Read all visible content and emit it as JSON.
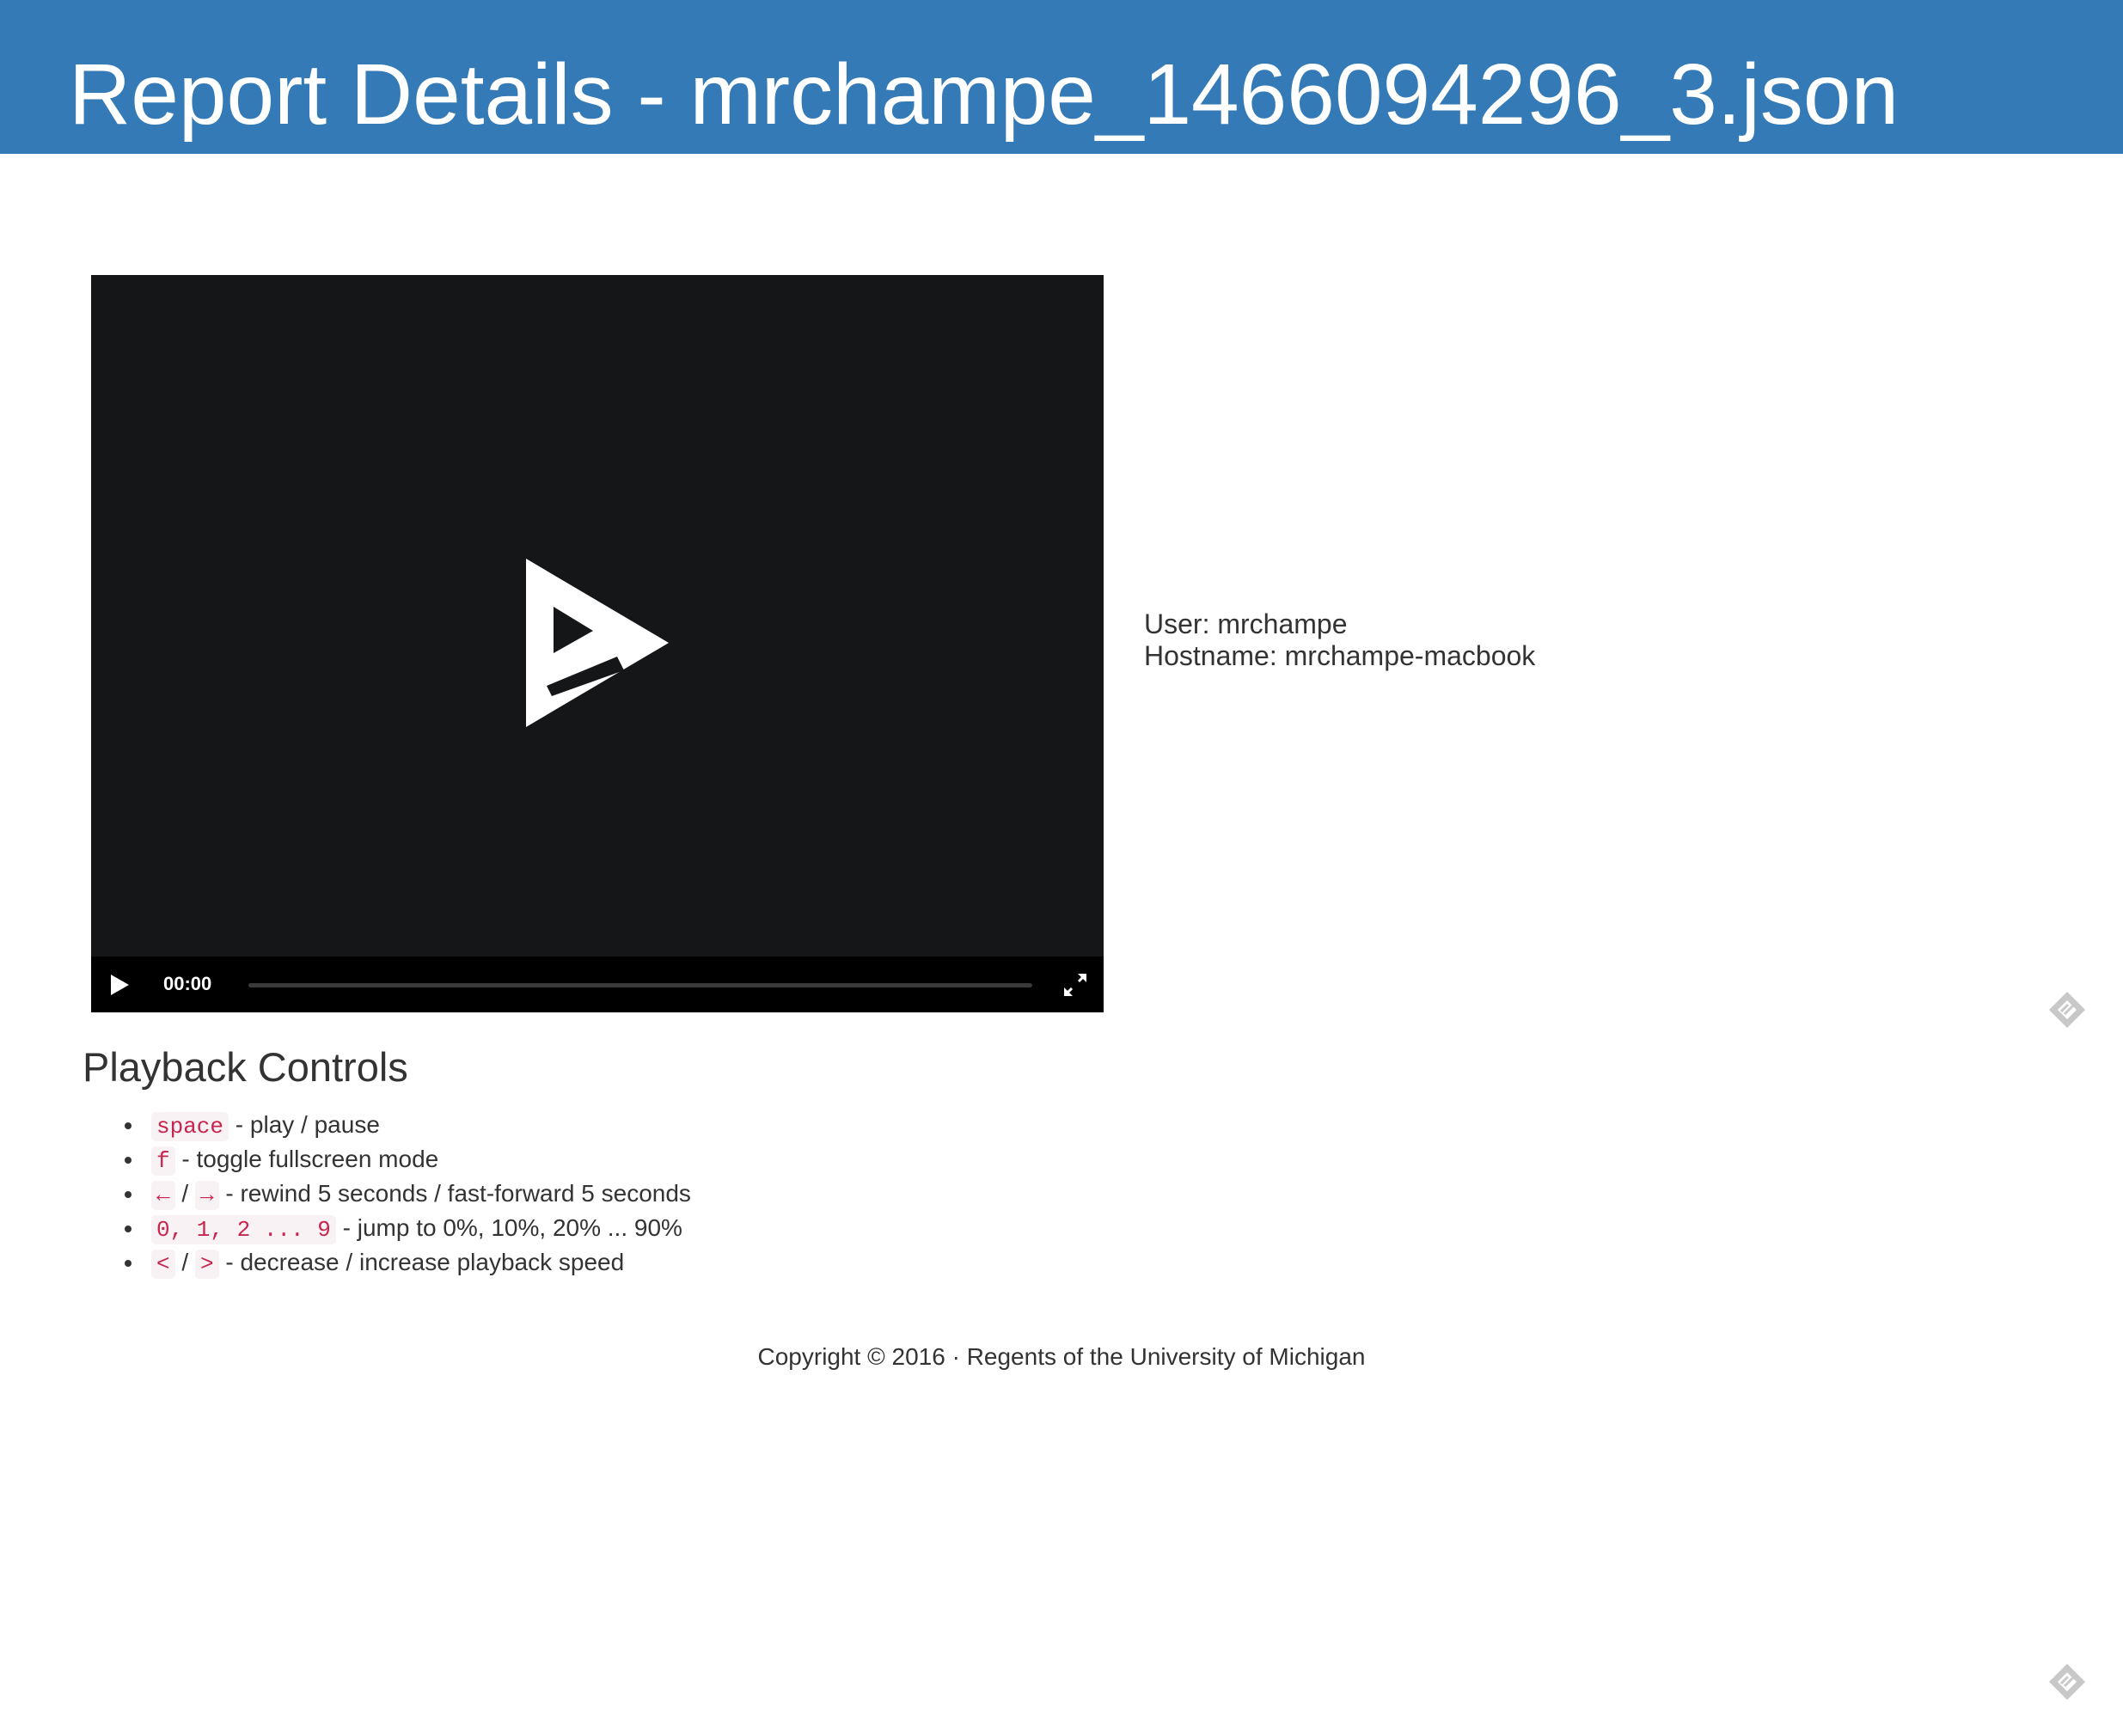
{
  "header": {
    "title": "Report Details - mrchampe_1466094296_3.json"
  },
  "player": {
    "time": "00:00",
    "icons": {
      "big_play": "asciinema-play-logo",
      "play": "play-icon",
      "fullscreen": "fullscreen-icon"
    }
  },
  "info": {
    "user": "User: mrchampe",
    "hostname": "Hostname: mrchampe-macbook"
  },
  "playback_controls": {
    "heading": "Playback Controls",
    "items": [
      {
        "keys": [
          "space"
        ],
        "sep": "",
        "desc": " - play / pause"
      },
      {
        "keys": [
          "f"
        ],
        "sep": "",
        "desc": " - toggle fullscreen mode"
      },
      {
        "keys": [
          "←",
          "→"
        ],
        "sep": " / ",
        "desc": " - rewind 5 seconds / fast-forward 5 seconds"
      },
      {
        "keys": [
          "0, 1, 2 ... 9"
        ],
        "sep": "",
        "desc": " - jump to 0%, 10%, 20% ... 90%"
      },
      {
        "keys": [
          "<",
          ">"
        ],
        "sep": " / ",
        "desc": " - decrease / increase playback speed"
      }
    ]
  },
  "footer": {
    "text": "Copyright © 2016 · Regents of the University of Michigan"
  },
  "colors": {
    "header_bg": "#337ab7",
    "player_bg": "#151618",
    "code_text": "#c7254e",
    "code_bg": "#f9f2f4"
  }
}
